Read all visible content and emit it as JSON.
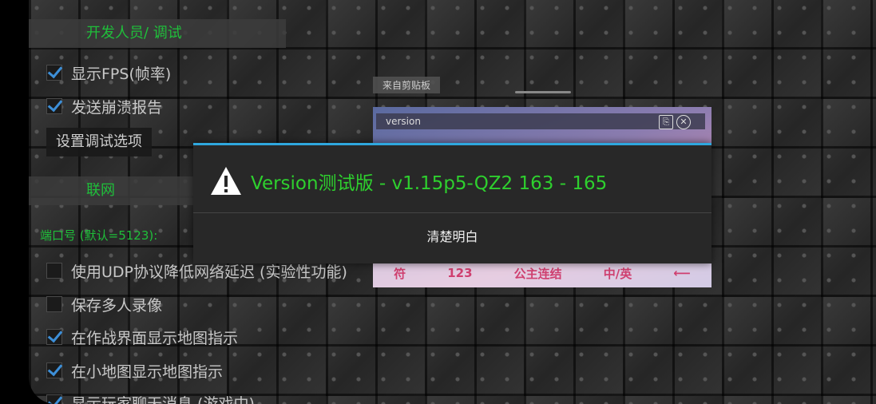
{
  "settings": {
    "dev_header": "开发人员/ 调试",
    "show_fps": "显示FPS(帧率)",
    "send_crash": "发送崩溃报告",
    "debug_options_button": "设置调试选项",
    "network_header": "联网",
    "port_label": "端口号 (默认=5123):",
    "udp": "使用UDP协议降低网络延迟 (实验性功能)",
    "save_multi": "保存多人录像",
    "map_battle": "在作战界面显示地图指示",
    "map_minimap": "在小地图显示地图指示",
    "chat": "显示玩家聊天消息 (游戏中)"
  },
  "keyboard": {
    "clipboard_tag": "来自剪贴板",
    "input_text": "version",
    "bar_items": [
      "符",
      "123",
      "公主连结",
      "中/英"
    ]
  },
  "dialog": {
    "title": "Version测试版 - v1.15p5-QZ2 163 - 165",
    "ok_button": "清楚明白"
  },
  "colors": {
    "accent": "#2fa7de",
    "green_text": "#2ed02e"
  }
}
